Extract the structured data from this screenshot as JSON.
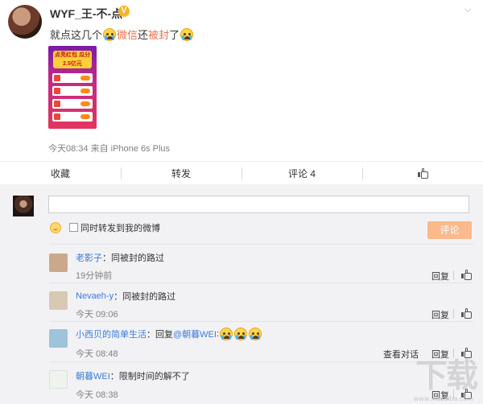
{
  "post": {
    "username": "WYF_王-不-点",
    "verified_badge": "V",
    "text_prefix": "就点这几个",
    "text_link1": "微信",
    "text_middle": "还",
    "text_link2": "被封",
    "text_suffix": "了",
    "image_banner": "点亮红包 瓜分2.5亿元",
    "meta": "今天08:34 来自 iPhone 6s Plus",
    "icons": {
      "verified": "verified-badge-icon",
      "menu": "chevron-down-icon",
      "emoji": "crying-face-icon"
    }
  },
  "actions": {
    "favorite": "收藏",
    "repost": "转发",
    "comment": "评论 4",
    "like_icon": "thumbs-up-icon"
  },
  "composer": {
    "input_value": "",
    "also_repost_label": "同时转发到我的微博",
    "submit_label": "评论",
    "submit_color": "#fbb98c"
  },
  "comments": [
    {
      "name": "老影子",
      "text": "：同被封的路过",
      "time": "19分钟前",
      "reply": "回复"
    },
    {
      "name": "Nevaeh-y",
      "text": "：同被封的路过",
      "time": "今天 09:06",
      "reply": "回复"
    },
    {
      "name": "小西贝的简单生活",
      "text": "：回复",
      "mention": "@朝暮WEI",
      "text2": ":",
      "time": "今天 08:48",
      "convo": "查看对话",
      "reply": "回复"
    },
    {
      "name": "朝暮WEI",
      "text": "：限制时间的解不了",
      "time": "今天 08:38",
      "reply": "回复"
    }
  ],
  "watermark": {
    "text": "下载",
    "url": "www.xiazaiba.com"
  },
  "colors": {
    "link": "#3a7bd5",
    "highlight": "#eb7350",
    "comments_bg": "#f2f2f5"
  }
}
